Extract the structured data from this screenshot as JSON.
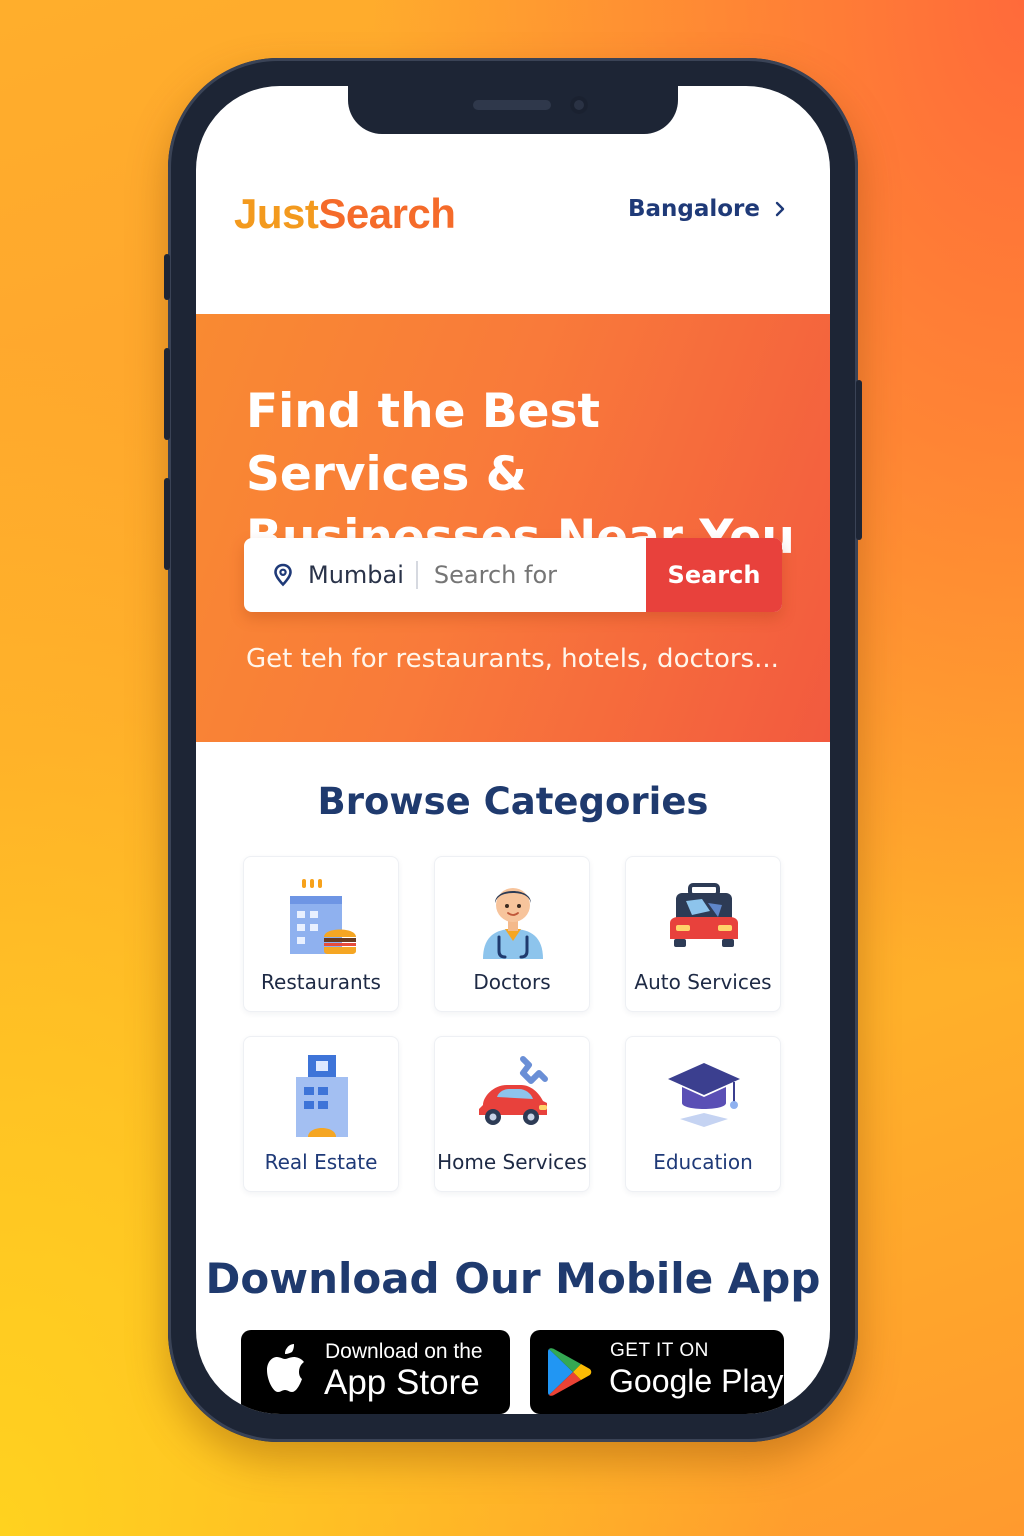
{
  "header": {
    "logo_part1": "Just",
    "logo_part2": "Search",
    "city": "Bangalore"
  },
  "hero": {
    "title": "Find the Best Services & Businesses Near You",
    "location": "Mumbai",
    "search_placeholder": "Search for",
    "search_button": "Search",
    "subtitle": "Get teh for restaurants, hotels, doctors..."
  },
  "categories": {
    "title": "Browse Categories",
    "items": [
      {
        "label": "Restaurants",
        "icon": "restaurant-building-icon"
      },
      {
        "label": "Doctors",
        "icon": "doctor-icon"
      },
      {
        "label": "Auto Services",
        "icon": "car-service-icon"
      },
      {
        "label": "Real Estate",
        "icon": "building-icon"
      },
      {
        "label": "Home Services",
        "icon": "car-wrench-icon"
      },
      {
        "label": "Education",
        "icon": "graduation-cap-icon"
      }
    ]
  },
  "download": {
    "title": "Download Our Mobile App",
    "appstore_small": "Download on the",
    "appstore_big": "App Store",
    "googleplay_small": "GET IT ON",
    "googleplay_big": "Google Play"
  },
  "colors": {
    "brand_orange": "#f39a1e",
    "hero_gradient_end": "#f25a3f",
    "search_button": "#e8413c",
    "navy_text": "#1f3a6e"
  }
}
